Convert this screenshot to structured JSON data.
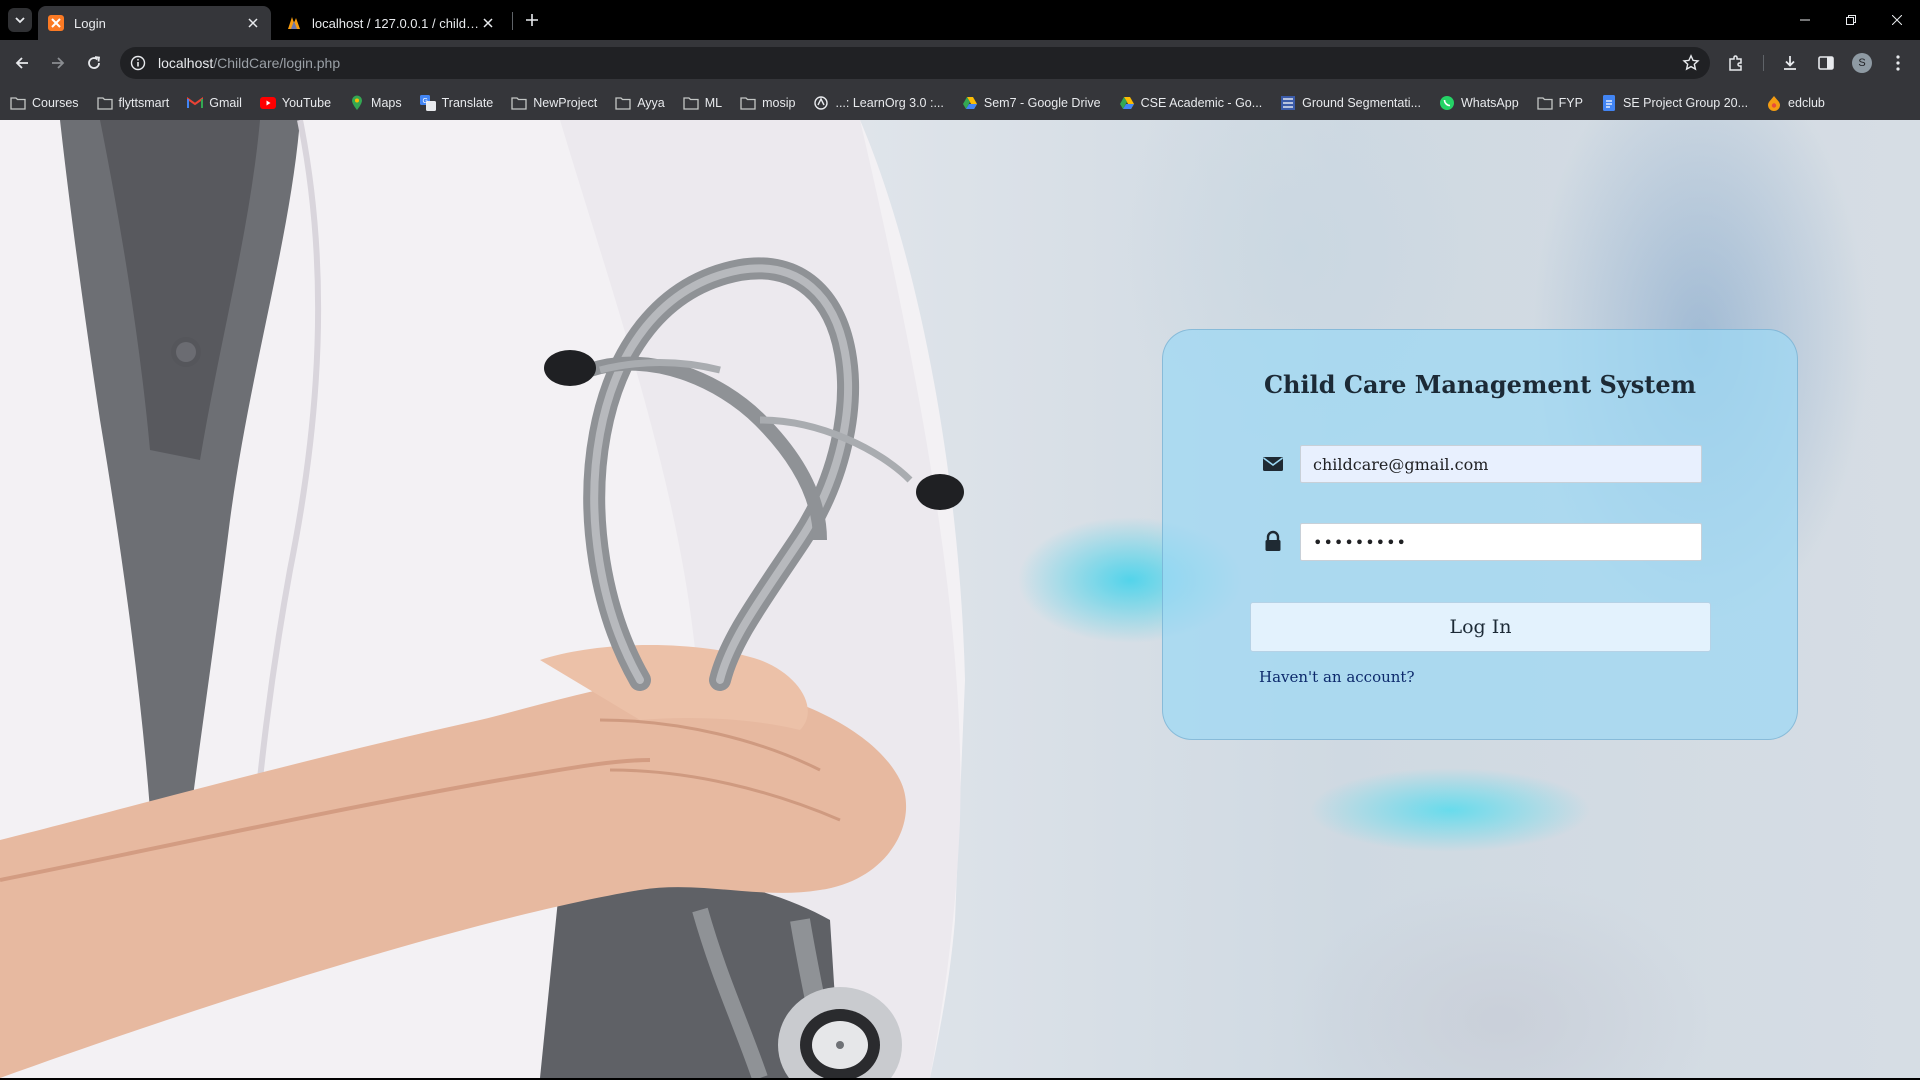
{
  "tabs": [
    {
      "title": "Login",
      "active": true,
      "favicon": "xampp-icon"
    },
    {
      "title": "localhost / 127.0.0.1 / child_care",
      "active": false,
      "favicon": "phpmyadmin-icon"
    }
  ],
  "address_bar": {
    "host": "localhost",
    "path": "/ChildCare/login.php"
  },
  "bookmarks": [
    {
      "label": "Courses",
      "icon": "folder-icon"
    },
    {
      "label": "flyttsmart",
      "icon": "folder-icon"
    },
    {
      "label": "Gmail",
      "icon": "gmail-icon"
    },
    {
      "label": "YouTube",
      "icon": "youtube-icon"
    },
    {
      "label": "Maps",
      "icon": "maps-icon"
    },
    {
      "label": "Translate",
      "icon": "translate-icon"
    },
    {
      "label": "NewProject",
      "icon": "folder-icon"
    },
    {
      "label": "Ayya",
      "icon": "folder-icon"
    },
    {
      "label": "ML",
      "icon": "folder-icon"
    },
    {
      "label": "mosip",
      "icon": "folder-icon"
    },
    {
      "label": "...: LearnOrg 3.0 :...",
      "icon": "globe-icon"
    },
    {
      "label": "Sem7 - Google Drive",
      "icon": "drive-icon"
    },
    {
      "label": "CSE Academic - Go...",
      "icon": "drive-icon"
    },
    {
      "label": "Ground Segmentati...",
      "icon": "ieee-icon"
    },
    {
      "label": "WhatsApp",
      "icon": "whatsapp-icon"
    },
    {
      "label": "FYP",
      "icon": "folder-icon"
    },
    {
      "label": "SE Project Group 20...",
      "icon": "docs-icon"
    },
    {
      "label": "edclub",
      "icon": "edclub-icon"
    }
  ],
  "profile": {
    "initial": "S"
  },
  "login": {
    "title": "Child Care Management System",
    "email_value": "childcare@gmail.com",
    "password_value": "•••••••••",
    "login_button": "Log In",
    "signup_link": "Haven't an account?"
  },
  "colors": {
    "card": "#9cd8f4",
    "button": "#e3f2fd",
    "link": "#0d2a6c",
    "autofill": "#e8f0fe"
  }
}
